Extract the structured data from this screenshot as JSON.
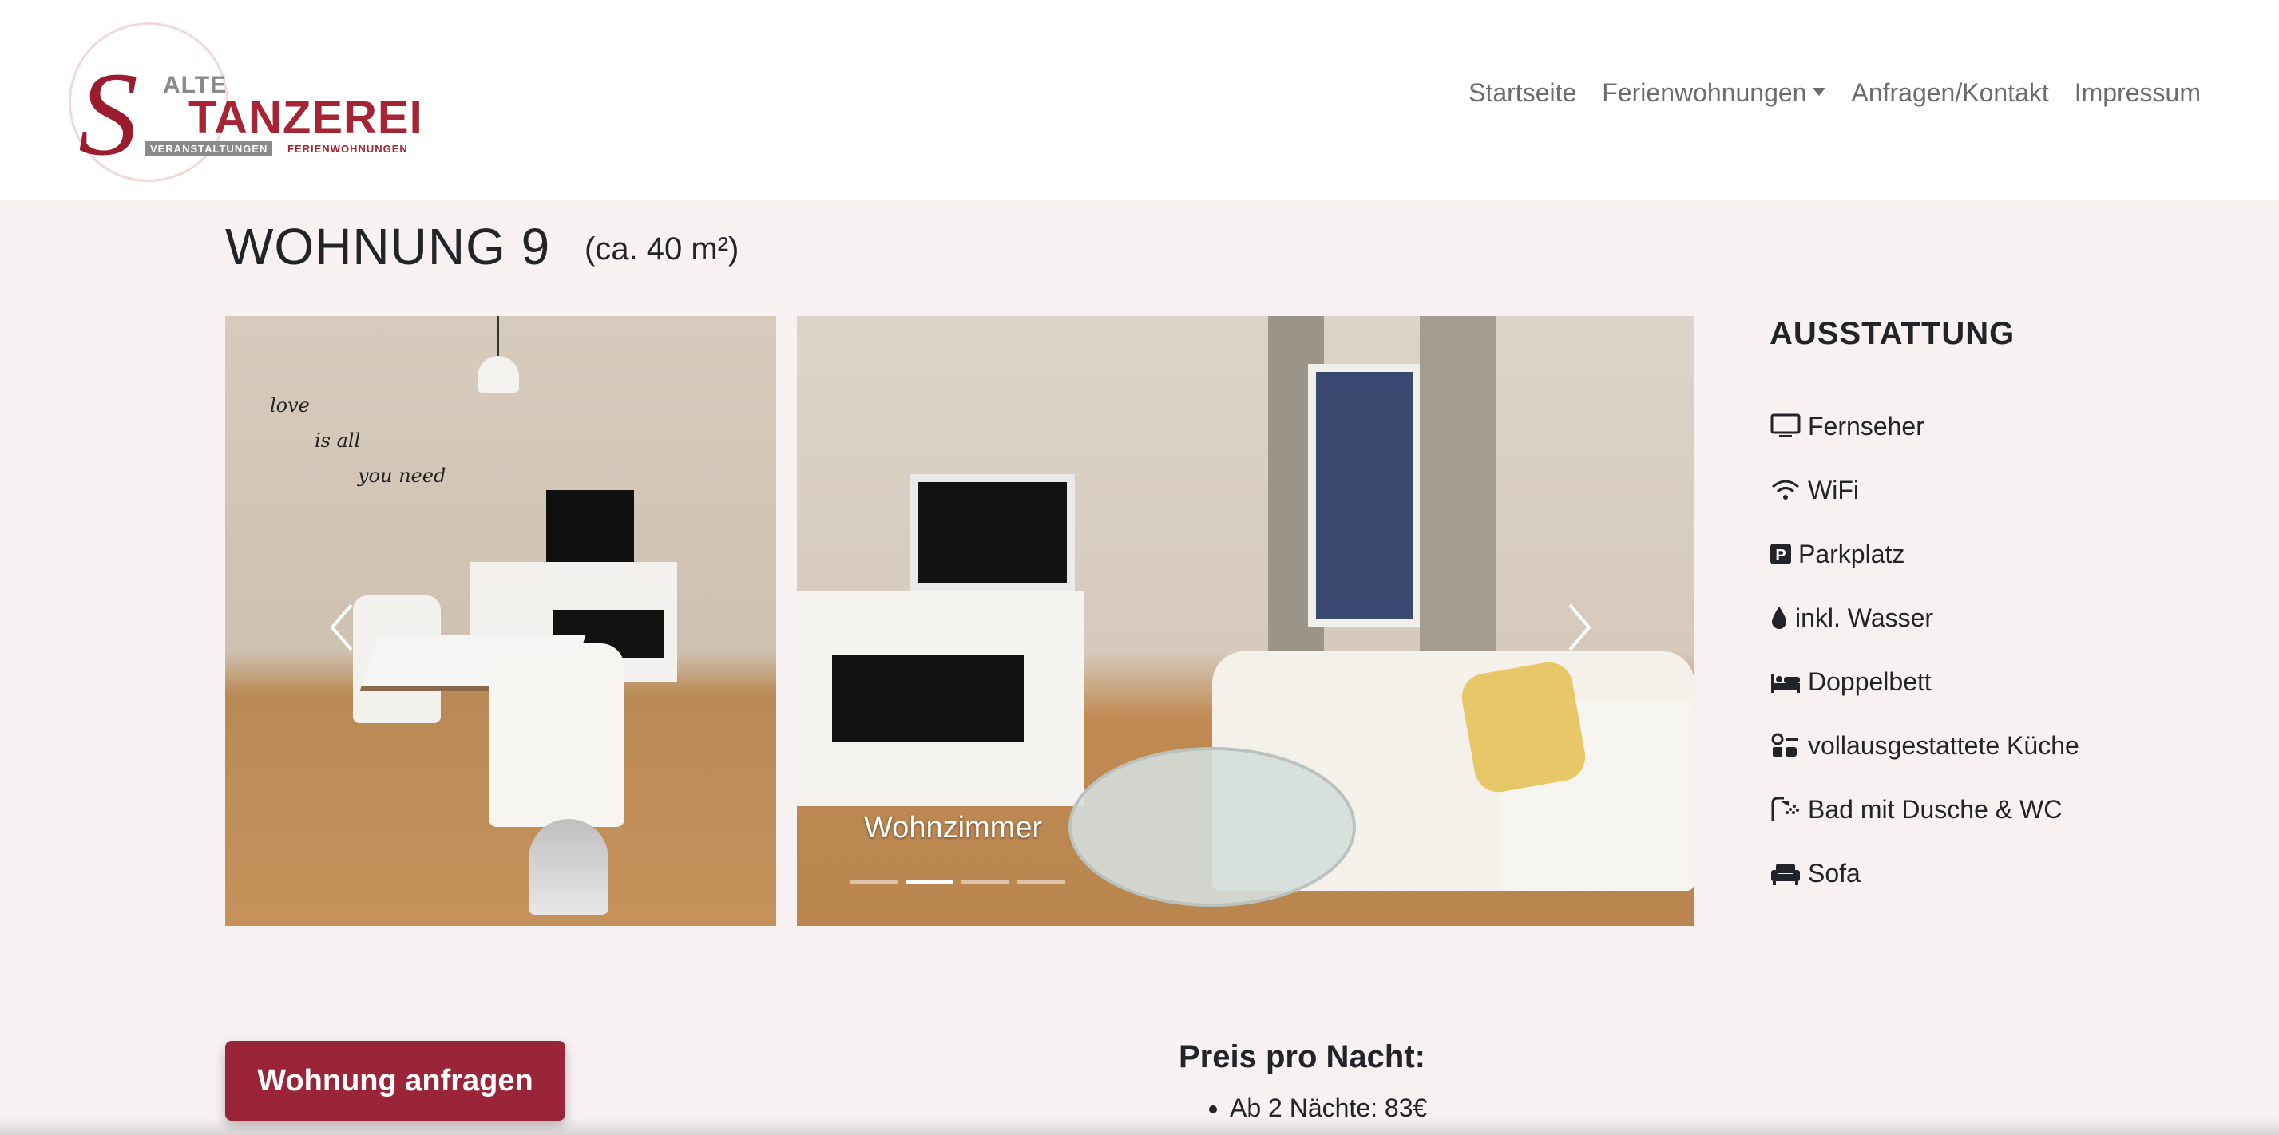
{
  "logo": {
    "alte": "ALTE",
    "s": "S",
    "tanzerei": "TANZEREI",
    "sub_left": "VERANSTALTUNGEN",
    "sub_right": "FERIENWOHNUNGEN"
  },
  "nav": {
    "items": [
      {
        "label": "Startseite"
      },
      {
        "label": "Ferienwohnungen"
      },
      {
        "label": "Anfragen/Kontakt"
      },
      {
        "label": "Impressum"
      }
    ]
  },
  "page": {
    "title": "WOHNUNG 9",
    "size": "(ca. 40 m²)"
  },
  "gallery": {
    "wall_text": [
      "love",
      "is all",
      "you need"
    ],
    "caption": "Wohnzimmer",
    "slide_count": 4,
    "active_slide": 2
  },
  "amenities": {
    "title": "AUSSTATTUNG",
    "items": [
      {
        "label": "Fernseher",
        "icon": "tv-icon"
      },
      {
        "label": "WiFi",
        "icon": "wifi-icon"
      },
      {
        "label": "Parkplatz",
        "icon": "parking-icon"
      },
      {
        "label": "inkl. Wasser",
        "icon": "water-drop-icon"
      },
      {
        "label": "Doppelbett",
        "icon": "bed-icon"
      },
      {
        "label": "vollausgestattete Küche",
        "icon": "kitchen-icon"
      },
      {
        "label": "Bad mit Dusche & WC",
        "icon": "shower-icon"
      },
      {
        "label": "Sofa",
        "icon": "sofa-icon"
      }
    ]
  },
  "booking": {
    "cta_label": "Wohnung anfragen",
    "price_title": "Preis pro Nacht:",
    "prices": [
      "Ab 2 Nächte: 83€"
    ]
  },
  "colors": {
    "brand": "#9a2538",
    "page_bg": "#f8f1f2",
    "nav_text": "#6c6c6c"
  }
}
